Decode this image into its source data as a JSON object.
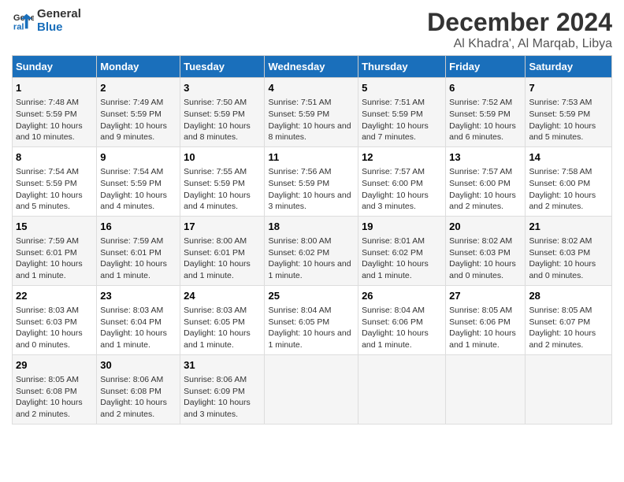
{
  "logo": {
    "line1": "General",
    "line2": "Blue"
  },
  "title": "December 2024",
  "subtitle": "Al Khadra', Al Marqab, Libya",
  "days_header": [
    "Sunday",
    "Monday",
    "Tuesday",
    "Wednesday",
    "Thursday",
    "Friday",
    "Saturday"
  ],
  "weeks": [
    [
      {
        "day": "1",
        "text": "Sunrise: 7:48 AM\nSunset: 5:59 PM\nDaylight: 10 hours and 10 minutes."
      },
      {
        "day": "2",
        "text": "Sunrise: 7:49 AM\nSunset: 5:59 PM\nDaylight: 10 hours and 9 minutes."
      },
      {
        "day": "3",
        "text": "Sunrise: 7:50 AM\nSunset: 5:59 PM\nDaylight: 10 hours and 8 minutes."
      },
      {
        "day": "4",
        "text": "Sunrise: 7:51 AM\nSunset: 5:59 PM\nDaylight: 10 hours and 8 minutes."
      },
      {
        "day": "5",
        "text": "Sunrise: 7:51 AM\nSunset: 5:59 PM\nDaylight: 10 hours and 7 minutes."
      },
      {
        "day": "6",
        "text": "Sunrise: 7:52 AM\nSunset: 5:59 PM\nDaylight: 10 hours and 6 minutes."
      },
      {
        "day": "7",
        "text": "Sunrise: 7:53 AM\nSunset: 5:59 PM\nDaylight: 10 hours and 5 minutes."
      }
    ],
    [
      {
        "day": "8",
        "text": "Sunrise: 7:54 AM\nSunset: 5:59 PM\nDaylight: 10 hours and 5 minutes."
      },
      {
        "day": "9",
        "text": "Sunrise: 7:54 AM\nSunset: 5:59 PM\nDaylight: 10 hours and 4 minutes."
      },
      {
        "day": "10",
        "text": "Sunrise: 7:55 AM\nSunset: 5:59 PM\nDaylight: 10 hours and 4 minutes."
      },
      {
        "day": "11",
        "text": "Sunrise: 7:56 AM\nSunset: 5:59 PM\nDaylight: 10 hours and 3 minutes."
      },
      {
        "day": "12",
        "text": "Sunrise: 7:57 AM\nSunset: 6:00 PM\nDaylight: 10 hours and 3 minutes."
      },
      {
        "day": "13",
        "text": "Sunrise: 7:57 AM\nSunset: 6:00 PM\nDaylight: 10 hours and 2 minutes."
      },
      {
        "day": "14",
        "text": "Sunrise: 7:58 AM\nSunset: 6:00 PM\nDaylight: 10 hours and 2 minutes."
      }
    ],
    [
      {
        "day": "15",
        "text": "Sunrise: 7:59 AM\nSunset: 6:01 PM\nDaylight: 10 hours and 1 minute."
      },
      {
        "day": "16",
        "text": "Sunrise: 7:59 AM\nSunset: 6:01 PM\nDaylight: 10 hours and 1 minute."
      },
      {
        "day": "17",
        "text": "Sunrise: 8:00 AM\nSunset: 6:01 PM\nDaylight: 10 hours and 1 minute."
      },
      {
        "day": "18",
        "text": "Sunrise: 8:00 AM\nSunset: 6:02 PM\nDaylight: 10 hours and 1 minute."
      },
      {
        "day": "19",
        "text": "Sunrise: 8:01 AM\nSunset: 6:02 PM\nDaylight: 10 hours and 1 minute."
      },
      {
        "day": "20",
        "text": "Sunrise: 8:02 AM\nSunset: 6:03 PM\nDaylight: 10 hours and 0 minutes."
      },
      {
        "day": "21",
        "text": "Sunrise: 8:02 AM\nSunset: 6:03 PM\nDaylight: 10 hours and 0 minutes."
      }
    ],
    [
      {
        "day": "22",
        "text": "Sunrise: 8:03 AM\nSunset: 6:03 PM\nDaylight: 10 hours and 0 minutes."
      },
      {
        "day": "23",
        "text": "Sunrise: 8:03 AM\nSunset: 6:04 PM\nDaylight: 10 hours and 1 minute."
      },
      {
        "day": "24",
        "text": "Sunrise: 8:03 AM\nSunset: 6:05 PM\nDaylight: 10 hours and 1 minute."
      },
      {
        "day": "25",
        "text": "Sunrise: 8:04 AM\nSunset: 6:05 PM\nDaylight: 10 hours and 1 minute."
      },
      {
        "day": "26",
        "text": "Sunrise: 8:04 AM\nSunset: 6:06 PM\nDaylight: 10 hours and 1 minute."
      },
      {
        "day": "27",
        "text": "Sunrise: 8:05 AM\nSunset: 6:06 PM\nDaylight: 10 hours and 1 minute."
      },
      {
        "day": "28",
        "text": "Sunrise: 8:05 AM\nSunset: 6:07 PM\nDaylight: 10 hours and 2 minutes."
      }
    ],
    [
      {
        "day": "29",
        "text": "Sunrise: 8:05 AM\nSunset: 6:08 PM\nDaylight: 10 hours and 2 minutes."
      },
      {
        "day": "30",
        "text": "Sunrise: 8:06 AM\nSunset: 6:08 PM\nDaylight: 10 hours and 2 minutes."
      },
      {
        "day": "31",
        "text": "Sunrise: 8:06 AM\nSunset: 6:09 PM\nDaylight: 10 hours and 3 minutes."
      },
      null,
      null,
      null,
      null
    ]
  ]
}
